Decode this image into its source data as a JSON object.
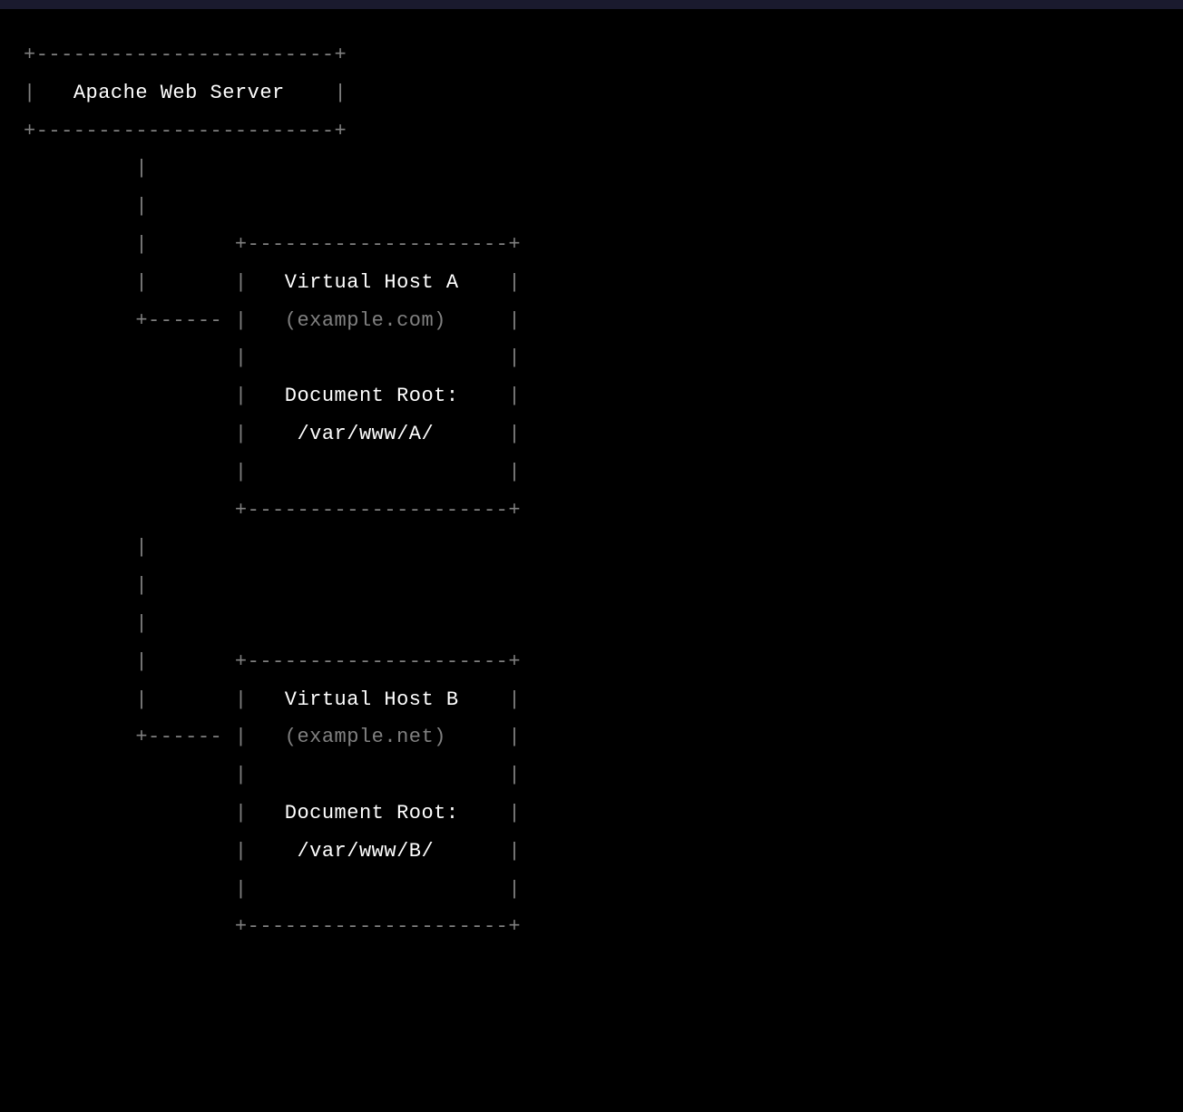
{
  "diagram": {
    "root": "Apache Web Server",
    "vhosts": [
      {
        "name": "Virtual Host A",
        "domain": "(example.com)",
        "docroot_label": "Document Root:",
        "docroot_path": "/var/www/A/"
      },
      {
        "name": "Virtual Host B",
        "domain": "(example.net)",
        "docroot_label": "Document Root:",
        "docroot_path": "/var/www/B/"
      }
    ]
  }
}
